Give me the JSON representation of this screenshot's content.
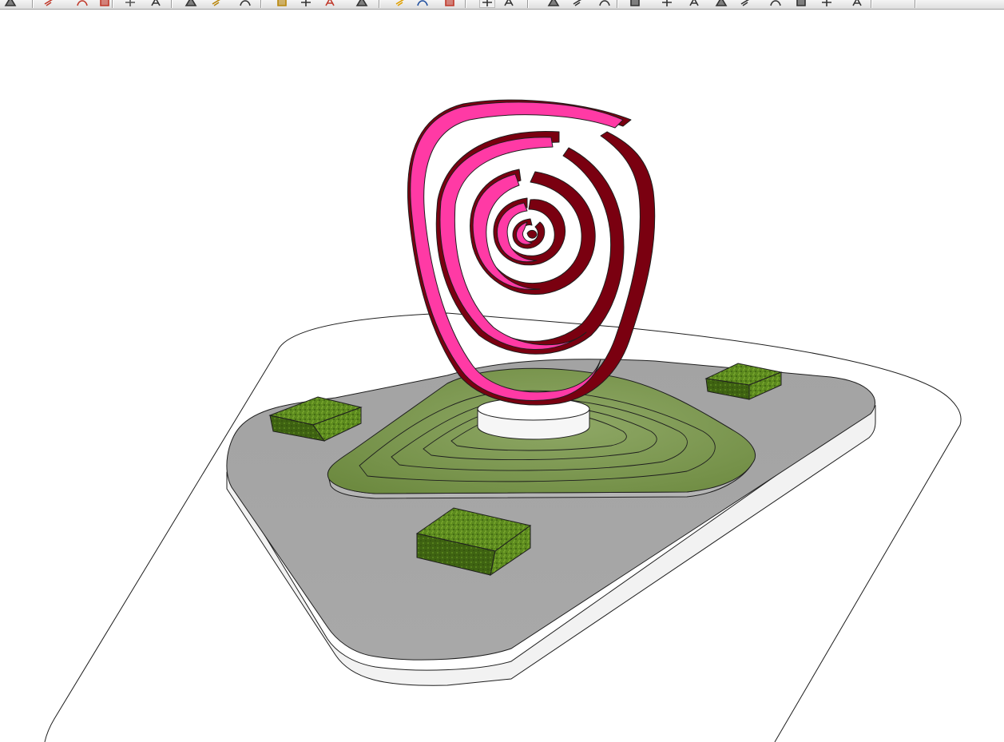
{
  "app": {
    "type": "3d-modeling-viewport"
  },
  "toolbar": {
    "buttons": [
      {
        "name": "select-tool-icon",
        "color": "#333333"
      },
      {
        "name": "eraser-tool-icon",
        "color": "#c0392b"
      },
      {
        "name": "line-tool-icon",
        "color": "#c0392b"
      },
      {
        "name": "arc-tool-icon",
        "color": "#c0392b"
      },
      {
        "name": "rectangle-tool-icon",
        "color": "#555555"
      },
      {
        "name": "push-pull-tool-icon",
        "color": "#333333"
      },
      {
        "name": "move-tool-icon",
        "color": "#333333"
      },
      {
        "name": "rotate-tool-icon",
        "color": "#b8860b"
      },
      {
        "name": "offset-tool-icon",
        "color": "#333333"
      },
      {
        "name": "tape-measure-tool-icon",
        "color": "#b8860b"
      },
      {
        "name": "dimension-tool-icon",
        "color": "#333333"
      },
      {
        "name": "text-tool-icon",
        "color": "#c0392b"
      },
      {
        "name": "orbit-tool-icon",
        "color": "#333333"
      },
      {
        "name": "pan-tool-icon",
        "color": "#e0a000"
      },
      {
        "name": "zoom-extents-icon",
        "color": "#1f4e9e"
      },
      {
        "name": "section-plane-icon",
        "color": "#c0392b"
      },
      {
        "name": "xray-style-icon",
        "color": "#333333"
      },
      {
        "name": "wireframe-style-icon",
        "color": "#333333"
      },
      {
        "name": "hidden-line-style-icon",
        "color": "#333333"
      },
      {
        "name": "shaded-style-icon",
        "color": "#333333"
      },
      {
        "name": "textured-style-icon",
        "color": "#333333"
      },
      {
        "name": "iso-view-icon",
        "color": "#333333"
      },
      {
        "name": "top-view-icon",
        "color": "#333333"
      },
      {
        "name": "front-view-icon",
        "color": "#333333"
      },
      {
        "name": "right-view-icon",
        "color": "#333333"
      },
      {
        "name": "back-view-icon",
        "color": "#333333"
      },
      {
        "name": "left-view-icon",
        "color": "#333333"
      },
      {
        "name": "components-icon",
        "color": "#333333"
      },
      {
        "name": "materials-icon",
        "color": "#333333"
      },
      {
        "name": "settings-icon",
        "color": "#333333"
      }
    ]
  },
  "scene": {
    "colors": {
      "sculpture_front": "#ff3aa5",
      "sculpture_side": "#7a0010",
      "plaza": "#a6a6a6",
      "plaza_edge": "#f2f2f2",
      "lawn": "#7d9a50",
      "lawn_dark": "#5a7a30",
      "hedge": "#5c8a1e",
      "hedge_side": "#3f6312",
      "plinth": "#ffffff",
      "outline": "#1e1e1e"
    }
  }
}
